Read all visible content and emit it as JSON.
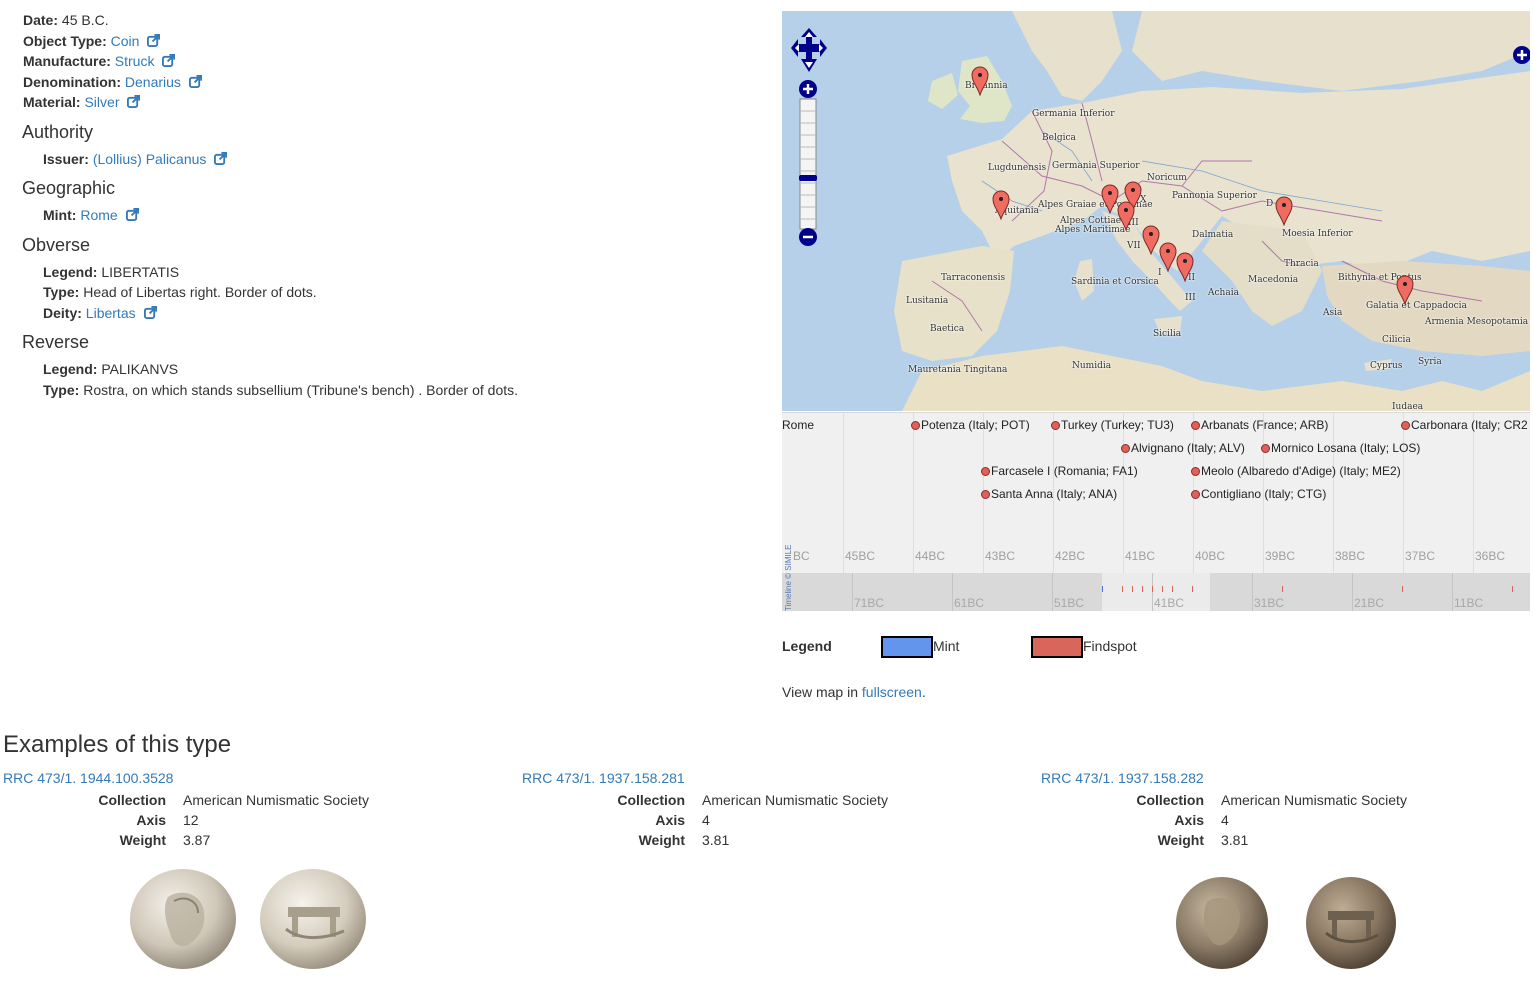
{
  "description": {
    "date_label": "Date:",
    "date_value": "45 B.C.",
    "object_type_label": "Object Type:",
    "object_type_value": "Coin",
    "manufacture_label": "Manufacture:",
    "manufacture_value": "Struck",
    "denomination_label": "Denomination:",
    "denomination_value": "Denarius",
    "material_label": "Material:",
    "material_value": "Silver",
    "authority_heading": "Authority",
    "issuer_label": "Issuer:",
    "issuer_value": "(Lollius) Palicanus",
    "geographic_heading": "Geographic",
    "mint_label": "Mint:",
    "mint_value": "Rome",
    "obverse_heading": "Obverse",
    "obv_legend_label": "Legend:",
    "obv_legend_value": "LIBERTATIS",
    "obv_type_label": "Type:",
    "obv_type_value": "Head of Libertas right. Border of dots.",
    "deity_label": "Deity:",
    "deity_value": "Libertas",
    "reverse_heading": "Reverse",
    "rev_legend_label": "Legend:",
    "rev_legend_value": "PALIKANVS",
    "rev_type_label": "Type:",
    "rev_type_value": "Rostra, on which stands subsellium (Tribune's bench) . Border of dots."
  },
  "map": {
    "labels": [
      "Britannia",
      "Germania Inferior",
      "Belgica",
      "Lugdunensis",
      "Germania Superior",
      "Noricum",
      "Aquitania",
      "Alpes Graiae et Poeninae",
      "X",
      "Pannonia Superior",
      "Alpes Cottiae",
      "Alpes Maritimae",
      "III",
      "VII",
      "Dalmatia",
      "D",
      "Moesia Inferior",
      "II",
      "I",
      "Tarraconensis",
      "Thracia",
      "Sardinia et Corsica",
      "Achaia",
      "Macedonia",
      "Bithynia et Pontus",
      "Galatia et Cappadocia",
      "Lusitania",
      "Asia",
      "Armenia Mesopotamia",
      "Baetica",
      "III",
      "Sicilia",
      "Cilicia",
      "Syria",
      "Cyprus",
      "Numidia",
      "Mauretania Tingitana",
      "Iudaea"
    ],
    "colors": {
      "sea": "#b5d0e8",
      "land": "#e8e2cf",
      "marker": "#f06c62",
      "controls": "#00008b"
    }
  },
  "timeline": {
    "upper_labels": [
      "BC",
      "45BC",
      "44BC",
      "43BC",
      "42BC",
      "41BC",
      "40BC",
      "39BC",
      "38BC",
      "37BC",
      "36BC"
    ],
    "lower_labels": [
      "71BC",
      "61BC",
      "51BC",
      "41BC",
      "31BC",
      "21BC",
      "11BC"
    ],
    "credit": "Timeline © SIMILE",
    "events": [
      {
        "label": "Rome",
        "type": "mint"
      },
      {
        "label": "Potenza (Italy; POT)",
        "type": "findspot"
      },
      {
        "label": "Turkey (Turkey; TU3)",
        "type": "findspot"
      },
      {
        "label": "Arbanats (France; ARB)",
        "type": "findspot"
      },
      {
        "label": "Carbonara (Italy; CR2",
        "type": "findspot"
      },
      {
        "label": "Alvignano (Italy; ALV)",
        "type": "findspot"
      },
      {
        "label": "Mornico Losana (Italy; LOS)",
        "type": "findspot"
      },
      {
        "label": "Farcasele I (Romania; FA1)",
        "type": "findspot"
      },
      {
        "label": "Meolo (Albaredo d'Adige) (Italy; ME2)",
        "type": "findspot"
      },
      {
        "label": "Santa Anna (Italy; ANA)",
        "type": "findspot"
      },
      {
        "label": "Contigliano (Italy; CTG)",
        "type": "findspot"
      }
    ]
  },
  "legend": {
    "label": "Legend",
    "mint_label": "Mint",
    "findspot_label": "Findspot",
    "mint_color": "#6495ed",
    "findspot_color": "#d9665b",
    "view_map_prefix": "View map in ",
    "view_map_link": "fullscreen",
    "view_map_suffix": "."
  },
  "examples": {
    "heading": "Examples of this type",
    "collection_label": "Collection",
    "axis_label": "Axis",
    "weight_label": "Weight",
    "items": [
      {
        "title": "RRC 473/1. 1944.100.3528",
        "collection": "American Numismatic Society",
        "axis": "12",
        "weight": "3.87"
      },
      {
        "title": "RRC 473/1. 1937.158.281",
        "collection": "American Numismatic Society",
        "axis": "4",
        "weight": "3.81"
      },
      {
        "title": "RRC 473/1. 1937.158.282",
        "collection": "American Numismatic Society",
        "axis": "4",
        "weight": "3.81"
      }
    ]
  }
}
